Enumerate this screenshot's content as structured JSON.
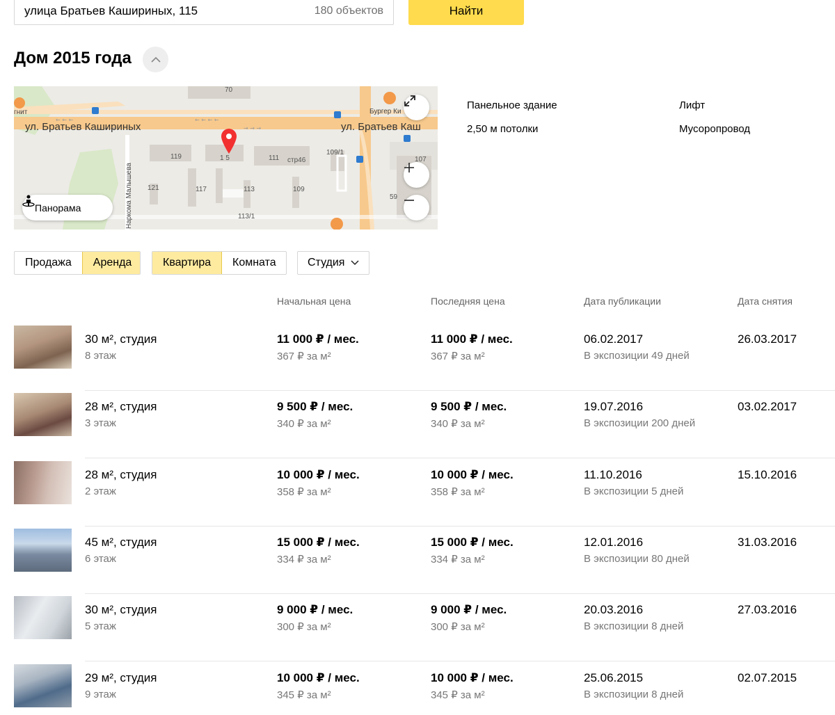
{
  "search": {
    "value": "улица Братьев Кашириных, 115",
    "count": "180 объектов",
    "button": "Найти"
  },
  "title": "Дом 2015 года",
  "map": {
    "street_label_left": "ул. Братьев Кашириных",
    "street_label_right": "ул. Братьев Каш",
    "vertical_street": "Наркома Малышева",
    "poi_burger": "Бургер Ки",
    "poi_left": "гнит",
    "building_numbers": [
      "70",
      "119",
      "1 5",
      "111",
      "стр46",
      "109/1",
      "107",
      "121",
      "117",
      "113",
      "109",
      "59",
      "113/1"
    ],
    "panorama_label": "Панорама"
  },
  "features": [
    "Панельное здание",
    "2,50 м потолки",
    "Лифт",
    "Мусоропровод"
  ],
  "filters": {
    "deal": [
      "Продажа",
      "Аренда"
    ],
    "deal_active": "Аренда",
    "type": [
      "Квартира",
      "Комната"
    ],
    "type_active": "Квартира",
    "rooms": "Студия"
  },
  "columns": [
    "Начальная цена",
    "Последняя цена",
    "Дата публикации",
    "Дата снятия"
  ],
  "rows": [
    {
      "area": "30 м², студия",
      "floor": "8 этаж",
      "start_price": "11 000 ₽ / мес.",
      "start_per_m": "367 ₽ за м²",
      "last_price": "11 000 ₽ / мес.",
      "last_per_m": "367 ₽ за м²",
      "published": "06.02.2017",
      "exposure": "В экспозиции 49 дней",
      "removed": "26.03.2017"
    },
    {
      "area": "28 м², студия",
      "floor": "3 этаж",
      "start_price": "9 500 ₽ / мес.",
      "start_per_m": "340 ₽ за м²",
      "last_price": "9 500 ₽ / мес.",
      "last_per_m": "340 ₽ за м²",
      "published": "19.07.2016",
      "exposure": "В экспозиции 200 дней",
      "removed": "03.02.2017"
    },
    {
      "area": "28 м², студия",
      "floor": "2 этаж",
      "start_price": "10 000 ₽ / мес.",
      "start_per_m": "358 ₽ за м²",
      "last_price": "10 000 ₽ / мес.",
      "last_per_m": "358 ₽ за м²",
      "published": "11.10.2016",
      "exposure": "В экспозиции 5 дней",
      "removed": "15.10.2016"
    },
    {
      "area": "45 м², студия",
      "floor": "6 этаж",
      "start_price": "15 000 ₽ / мес.",
      "start_per_m": "334 ₽ за м²",
      "last_price": "15 000 ₽ / мес.",
      "last_per_m": "334 ₽ за м²",
      "published": "12.01.2016",
      "exposure": "В экспозиции 80 дней",
      "removed": "31.03.2016"
    },
    {
      "area": "30 м², студия",
      "floor": "5 этаж",
      "start_price": "9 000 ₽ / мес.",
      "start_per_m": "300 ₽ за м²",
      "last_price": "9 000 ₽ / мес.",
      "last_per_m": "300 ₽ за м²",
      "published": "20.03.2016",
      "exposure": "В экспозиции 8 дней",
      "removed": "27.03.2016"
    },
    {
      "area": "29 м², студия",
      "floor": "9 этаж",
      "start_price": "10 000 ₽ / мес.",
      "start_per_m": "345 ₽ за м²",
      "last_price": "10 000 ₽ / мес.",
      "last_per_m": "345 ₽ за м²",
      "published": "25.06.2015",
      "exposure": "В экспозиции 8 дней",
      "removed": "02.07.2015"
    }
  ],
  "colors": {
    "accent": "#ffdb4d",
    "accent_light": "#ffeba0",
    "road": "#f7c98c",
    "map_bg": "#ecebe6",
    "pin": "#f23030"
  }
}
